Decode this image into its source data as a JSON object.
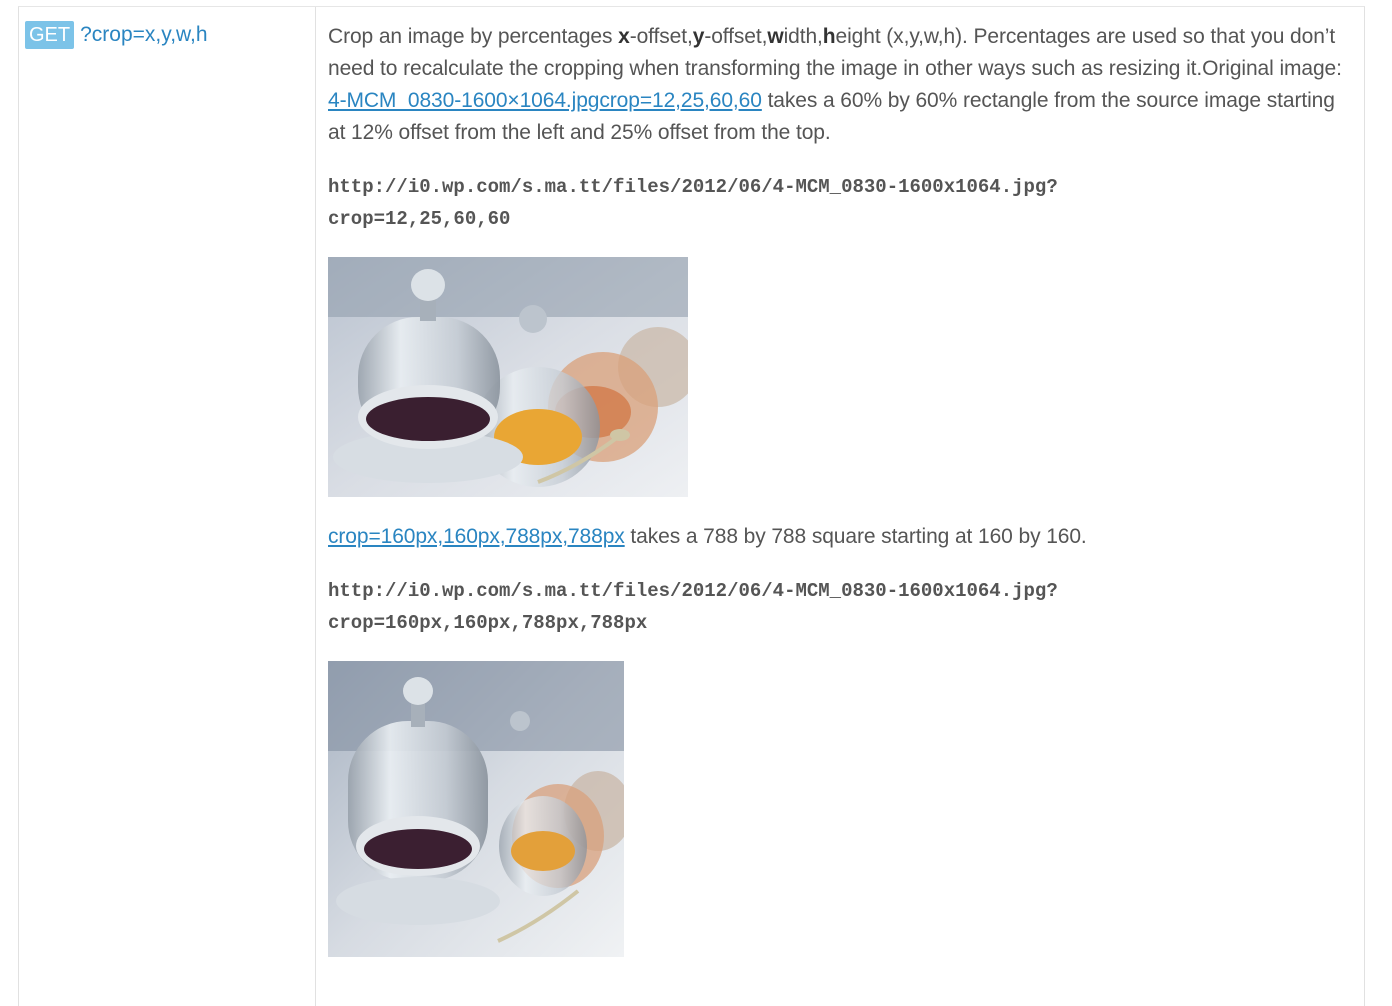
{
  "param": {
    "method": "GET",
    "name": "?crop=x,y,w,h"
  },
  "description": {
    "intro": "Crop an image by percentages ",
    "x": "x",
    "x_rest": "-offset,",
    "y": "y",
    "y_rest": "-offset,",
    "w": "w",
    "w_rest": "idth,",
    "h": "h",
    "h_rest": "eight (x,y,w,h). Percentages are used so that you don’t need to recalculate the cropping when transforming the image in other ways such as resizing it.Original image: ",
    "link_text": "4-MCM_0830-1600×1064.jpgcrop=12,25,60,60",
    "after_link": " takes a 60% by 60% rectangle from the source image starting at 12% offset from the left and 25% offset from the top."
  },
  "example1": {
    "url_line1": "http://i0.wp.com/s.ma.tt/files/2012/06/4-MCM_0830-1600x1064.jpg?",
    "url_line2": "crop=12,25,60,60"
  },
  "example2": {
    "link_text": "crop=160px,160px,788px,788px",
    "after_link": " takes a 788 by 788 square starting at 160 by 160.",
    "url_line1": "http://i0.wp.com/s.ma.tt/files/2012/06/4-MCM_0830-1600x1064.jpg?",
    "url_line2": "crop=160px,160px,788px,788px"
  },
  "colors": {
    "badge": "#7cc3e8",
    "link": "#2a85c1",
    "text": "#555555"
  }
}
